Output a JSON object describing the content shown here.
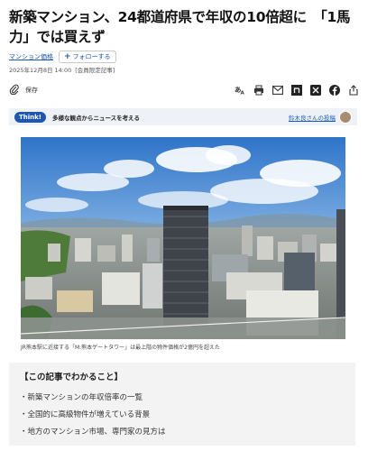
{
  "headline": "新築マンション、24都道府県で年収の10倍超に　「1馬力」では買えず",
  "meta": {
    "topic_link": "マンション価格",
    "follow_label": "フォローする"
  },
  "dateline": {
    "date": "2025年12月8日 14:00",
    "tag": "[会員限定記事]"
  },
  "toolbar": {
    "save_label": "保存",
    "icons": [
      "paperclip-icon",
      "text-size-icon",
      "print-icon",
      "mail-icon",
      "note-icon",
      "x-icon",
      "facebook-icon",
      "share-icon"
    ]
  },
  "think": {
    "badge": "Think!",
    "text": "多様な観点からニュースを考える",
    "link": "鈴木良さんの投稿"
  },
  "photo": {
    "caption": "JR熊本駅に近接する「M:熊本ゲートタワー」は最上階の物件価格が2億円を超えた"
  },
  "summary": {
    "title": "【この記事でわかること】",
    "items": [
      "新築マンションの年収倍率の一覧",
      "全国的に高級物件が増えている背景",
      "地方のマンション市場、専門家の見方は"
    ]
  },
  "colors": {
    "link": "#1a5ab8",
    "think_badge": "#1f56b0",
    "think_bar": "#eef1f6",
    "summary_bg": "#f3f3f3"
  }
}
